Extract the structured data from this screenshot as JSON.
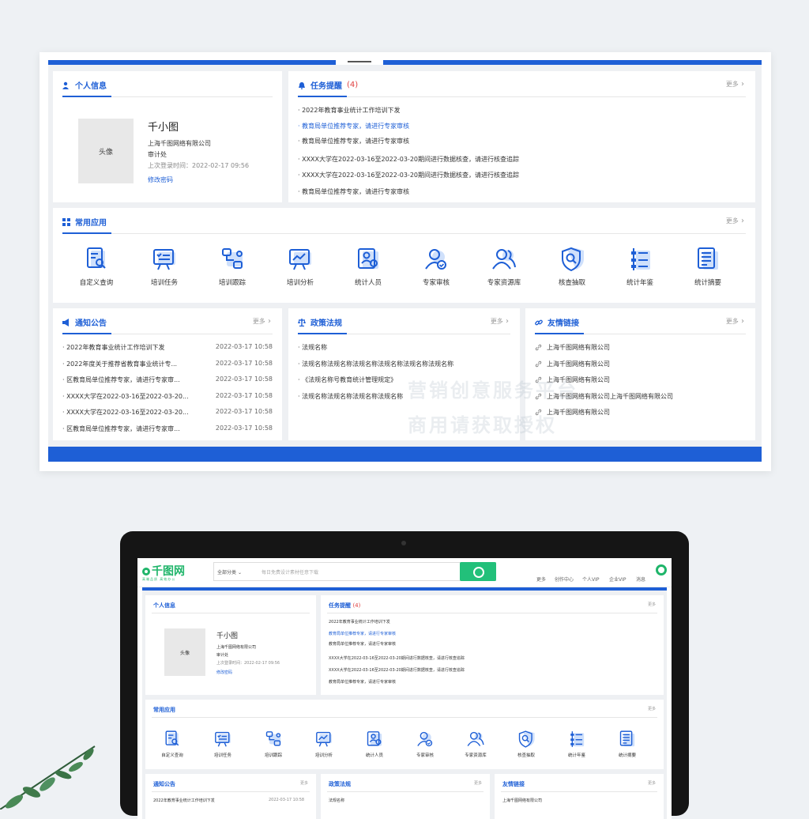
{
  "profile": {
    "title": "个人信息",
    "avatar_label": "头像",
    "name": "千小图",
    "company": "上海千图网络有限公司",
    "dept": "审计处",
    "last_login": "上次登录时间：2022-02-17   09:56",
    "change_password": "修改密码"
  },
  "tasks": {
    "title": "任务提醒",
    "count": "(4)",
    "more": "更多",
    "items": [
      "2022年教育事业统计工作培训下发",
      "教育局单位推荐专家，请进行专家审核",
      "教育局单位推荐专家，请进行专家审核",
      "XXXX大学在2022-03-16至2022-03-20期间进行数据核查，请进行核查追踪",
      "XXXX大学在2022-03-16至2022-03-20期间进行数据核查，请进行核查追踪",
      "教育局单位推荐专家，请进行专家审核"
    ]
  },
  "apps": {
    "title": "常用应用",
    "more": "更多",
    "items": [
      {
        "label": "自定义查询",
        "icon": "document-search-icon"
      },
      {
        "label": "培训任务",
        "icon": "checklist-board-icon"
      },
      {
        "label": "培训跟踪",
        "icon": "flow-track-icon"
      },
      {
        "label": "培训分析",
        "icon": "chart-board-icon"
      },
      {
        "label": "统计人员",
        "icon": "user-card-icon"
      },
      {
        "label": "专家审核",
        "icon": "user-check-icon"
      },
      {
        "label": "专家资源库",
        "icon": "users-icon"
      },
      {
        "label": "核查抽取",
        "icon": "shield-search-icon"
      },
      {
        "label": "统计年鉴",
        "icon": "yearbook-icon"
      },
      {
        "label": "统计摘要",
        "icon": "summary-doc-icon"
      }
    ]
  },
  "notices": {
    "title": "通知公告",
    "more": "更多",
    "items": [
      {
        "text": "2022年教育事业统计工作培训下发",
        "date": "2022-03-17  10:58"
      },
      {
        "text": "2022年度关于推荐省教育事业统计专...",
        "date": "2022-03-17  10:58"
      },
      {
        "text": "区教育局单位推荐专家，请进行专家审...",
        "date": "2022-03-17  10:58"
      },
      {
        "text": "XXXX大学在2022-03-16至2022-03-20...",
        "date": "2022-03-17  10:58"
      },
      {
        "text": "XXXX大学在2022-03-16至2022-03-20...",
        "date": "2022-03-17  10:58"
      },
      {
        "text": "区教育局单位推荐专家，请进行专家审...",
        "date": "2022-03-17  10:58"
      }
    ]
  },
  "policies": {
    "title": "政策法规",
    "more": "更多",
    "items": [
      "法规名称",
      "法规名称法规名称法规名称法规名称法规名称法规名称",
      "《法规名称号教育统计管理规定》",
      "法规名称法规名称法规名称法规名称"
    ]
  },
  "links": {
    "title": "友情链接",
    "more": "更多",
    "items": [
      "上海千图网络有限公司",
      "上海千图网络有限公司",
      "上海千图网络有限公司",
      "上海千图网络有限公司上海千图网络有限公司",
      "上海千图网络有限公司"
    ]
  },
  "watermark": {
    "line1": "营销创意服务平台",
    "line2": "商用请获取授权"
  },
  "laptop": {
    "logo": "千图网",
    "logo_sub": "高端品质  高效办公",
    "search_category": "全部分类",
    "search_placeholder": "每日免费设计素材任意下载",
    "nav": [
      "更多",
      "创作中心",
      "个人VIP",
      "企业VIP",
      "消息"
    ]
  },
  "colors": {
    "accent": "#1e5fd6",
    "brand_green": "#1fb56a"
  }
}
